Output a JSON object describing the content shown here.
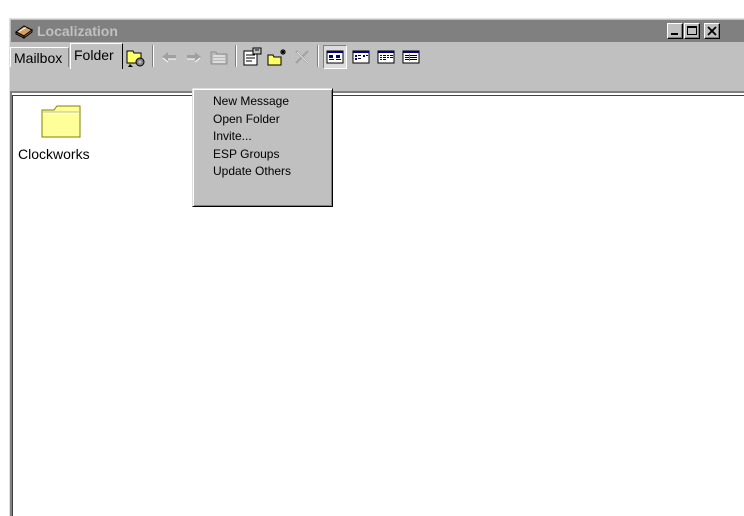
{
  "window": {
    "title": "Localization",
    "title_bar_color": "#808080",
    "title_text_color": "#c0c0c0"
  },
  "icons": {
    "app": "book-icon",
    "minimize": "minimize-icon",
    "maximize": "maximize-icon",
    "close": "close-icon"
  },
  "tabs": [
    {
      "label": "Mailbox",
      "active": false
    },
    {
      "label": "Folder",
      "active": true
    }
  ],
  "toolbar": {
    "buttons": [
      {
        "name": "folder-actions",
        "icon": "folder-gear-icon"
      },
      {
        "name": "back",
        "icon": "back-arrow-icon",
        "enabled": false
      },
      {
        "name": "forward",
        "icon": "forward-arrow-icon",
        "enabled": false
      },
      {
        "name": "up-folder",
        "icon": "up-folder-icon",
        "enabled": false
      },
      {
        "name": "properties",
        "icon": "properties-icon"
      },
      {
        "name": "new-folder",
        "icon": "new-folder-icon"
      },
      {
        "name": "delete",
        "icon": "delete-icon",
        "enabled": false
      },
      {
        "name": "large-icons-view",
        "icon": "large-icons-view-icon",
        "pressed": true
      },
      {
        "name": "small-icons-view",
        "icon": "small-icons-view-icon"
      },
      {
        "name": "list-view",
        "icon": "list-view-icon"
      },
      {
        "name": "details-view",
        "icon": "details-view-icon"
      }
    ]
  },
  "context_menu": {
    "items": [
      "New Message",
      "Open Folder",
      "Invite...",
      "ESP Groups",
      "Update Others"
    ]
  },
  "content": {
    "items": [
      {
        "label": "Clockworks",
        "icon": "folder-icon"
      }
    ]
  },
  "colors": {
    "face": "#c0c0c0",
    "folder": "#ffff99"
  }
}
